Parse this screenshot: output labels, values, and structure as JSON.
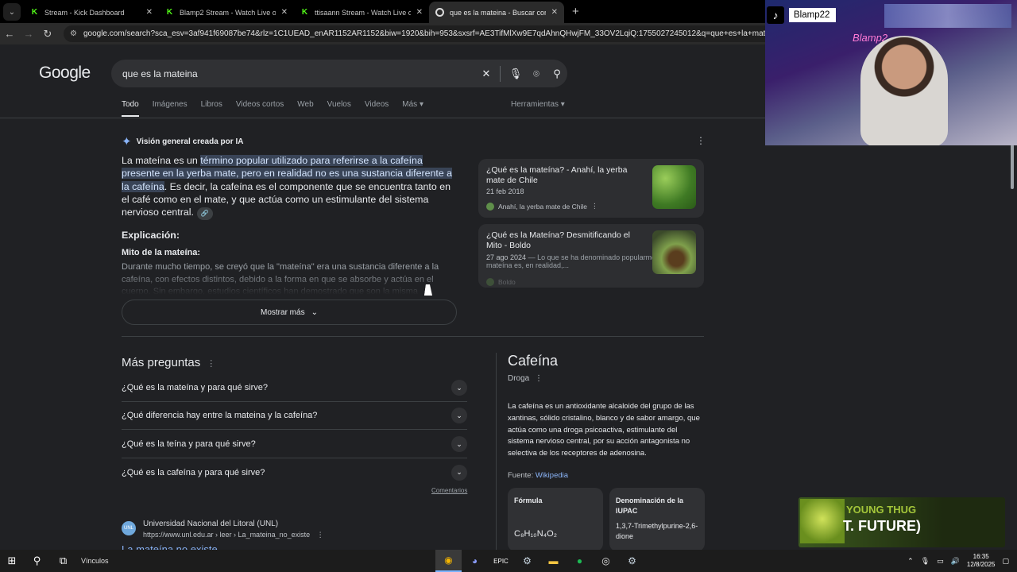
{
  "browser": {
    "tabs": [
      {
        "title": "Stream - Kick Dashboard",
        "favicon": "kick-icon",
        "active": false
      },
      {
        "title": "Blamp2 Stream - Watch Live on",
        "favicon": "kick-icon",
        "active": false
      },
      {
        "title": "ttisaann Stream - Watch Live on",
        "favicon": "kick-icon",
        "active": false
      },
      {
        "title": "que es la mateina - Buscar con",
        "favicon": "google-icon",
        "active": true
      }
    ],
    "url": "google.com/search?sca_esv=3af941f69087be74&rlz=1C1UEAD_enAR1152AR1152&biw=1920&bih=953&sxsrf=AE3TifMlXw9E7qdAhnQHwjFM_33OV2LqiQ:1755027245012&q=que+es+la+mateina&source=lnms"
  },
  "google": {
    "logo": "Google",
    "query": "que es la mateina",
    "filters": [
      "Todo",
      "Imágenes",
      "Libros",
      "Videos cortos",
      "Web",
      "Vuelos",
      "Videos",
      "Más ▾"
    ],
    "tools": "Herramientas ▾",
    "ai_overview": {
      "label": "Visión general creada por IA",
      "text_before": "La mateína es un ",
      "text_highlight": "término popular utilizado para referirse a la cafeína presente en la yerba mate, pero en realidad no es una sustancia diferente a la cafeína",
      "text_after": ". Es decir, la cafeína es el componente que se encuentra tanto en el café como en el mate, y que actúa como un estimulante del sistema nervioso central.",
      "explanation_heading": "Explicación:",
      "myth_heading": "Mito de la mateína:",
      "myth_text": "Durante mucho tiempo, se creyó que la \"mateína\" era una sustancia diferente a la cafeína, con efectos distintos, debido a la forma en que se absorbe y actúa en el cuerpo. Sin embargo, estudios científicos han demostrado que son la misma molécula.",
      "show_more": "Mostrar más",
      "sources": [
        {
          "title": "¿Qué es la mateína? - Anahí, la yerba mate de Chile",
          "date": "21 feb 2018",
          "snippet": "",
          "site": "Anahí, la yerba mate de Chile"
        },
        {
          "title": "¿Qué es la Mateína? Desmitificando el Mito - Boldo",
          "date": "27 ago 2024",
          "snippet": "— Lo que se ha denominado popularmente como mateína es, en realidad,...",
          "site": "Boldo"
        }
      ]
    },
    "paa": {
      "title": "Más preguntas",
      "questions": [
        "¿Qué es la mateína y para qué sirve?",
        "¿Qué diferencia hay entre la mateina y la cafeína?",
        "¿Qué es la teína y para qué sirve?",
        "¿Qué es la cafeína y para qué sirve?"
      ],
      "feedback": "Comentarios"
    },
    "result": {
      "icon_text": "UNL",
      "site": "Universidad Nacional del Litoral (UNL)",
      "url": "https://www.unl.edu.ar › leer › La_mateina_no_existe",
      "title": "La mateína no existe"
    },
    "knowledge_panel": {
      "title": "Cafeína",
      "subtitle": "Droga",
      "description": "La cafeína es un antioxidante alcaloide del grupo de las xantinas, sólido cristalino, blanco y de sabor amargo, que actúa como una droga psicoactiva, estimulante del sistema nervioso central, por su acción antagonista no selectiva de los receptores de adenosina.",
      "source_label": "Fuente:",
      "source_link": "Wikipedia",
      "cards": [
        {
          "key": "Fórmula",
          "value": "C₈H₁₀N₄O₂"
        },
        {
          "key": "Denominación de la IUPAC",
          "value": "1,3,7-Trimethylpurine-2,6-dione"
        }
      ]
    }
  },
  "overlays": {
    "tiktok_name": "Blamp22",
    "neon_sign": "Blamp2",
    "music_artist": "YOUNG THUG",
    "music_song": "T. FUTURE)"
  },
  "taskbar": {
    "links_label": "Vínculos",
    "time": "16:35",
    "date": "12/8/2025"
  }
}
